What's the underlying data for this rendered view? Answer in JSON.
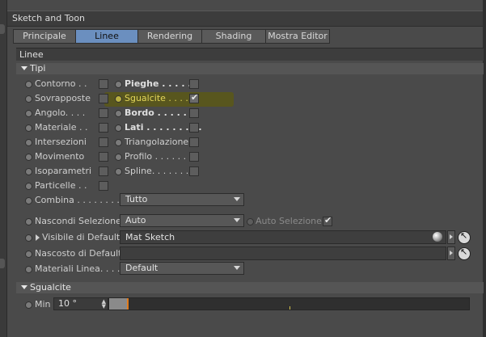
{
  "window": {
    "title": "Sketch and Toon"
  },
  "tabs": [
    {
      "label": "Principale",
      "active": false
    },
    {
      "label": "Linee",
      "active": true
    },
    {
      "label": "Rendering",
      "active": false
    },
    {
      "label": "Shading",
      "active": false
    },
    {
      "label": "Mostra Editor",
      "active": false
    }
  ],
  "section": {
    "title": "Linee"
  },
  "group_tipi": {
    "title": "Tipi"
  },
  "left_options": [
    {
      "label": "Contorno . .",
      "checked": false
    },
    {
      "label": "Sovrapposte",
      "checked": false
    },
    {
      "label": "Angolo. . . .",
      "checked": false
    },
    {
      "label": "Materiale . .",
      "checked": false
    },
    {
      "label": "Intersezioni",
      "checked": false
    },
    {
      "label": "Movimento",
      "checked": false
    },
    {
      "label": "Isoparametri",
      "checked": false
    },
    {
      "label": "Particelle . .",
      "checked": false
    }
  ],
  "right_options": [
    {
      "label": "Pieghe . . . . . .",
      "checked": false,
      "bold": true
    },
    {
      "label": "Sgualcite . . . . .",
      "checked": true,
      "bold": false,
      "highlight": true,
      "check_glyph": "✔"
    },
    {
      "label": "Bordo . . . . . . .",
      "checked": false,
      "bold": true
    },
    {
      "label": "Lati . . . . . . . . .",
      "checked": false,
      "bold": true
    },
    {
      "label": "Triangolazione",
      "checked": false,
      "bold": false
    },
    {
      "label": "Profilo . . . . . .",
      "checked": false,
      "bold": false
    },
    {
      "label": "Spline. . . . . . .",
      "checked": false,
      "bold": false
    }
  ],
  "combina": {
    "label": "Combina . . . . . . . . . .",
    "value": "Tutto"
  },
  "nascondi": {
    "label": "Nascondi Selezione",
    "value": "Auto",
    "auto_label": "Auto Selezione",
    "auto_glyph": "✔"
  },
  "visibile": {
    "label": "Visibile di Default",
    "value": "Mat Sketch"
  },
  "nascosto": {
    "label": "Nascosto di Default",
    "value": ""
  },
  "materiali": {
    "label": "Materiali Linea. . . . . .",
    "value": "Default"
  },
  "group_sgualcite": {
    "title": "Sgualcite"
  },
  "min": {
    "label": "Min",
    "value": "10 °",
    "fraction": 0.05
  },
  "glyphs": {
    "pick": "↖",
    "spin_up": "▲",
    "spin_down": "▼"
  },
  "colors": {
    "accent_tab": "#6b8fbf",
    "highlight": "#e3d65a",
    "slider_knob": "#e07b1c"
  }
}
